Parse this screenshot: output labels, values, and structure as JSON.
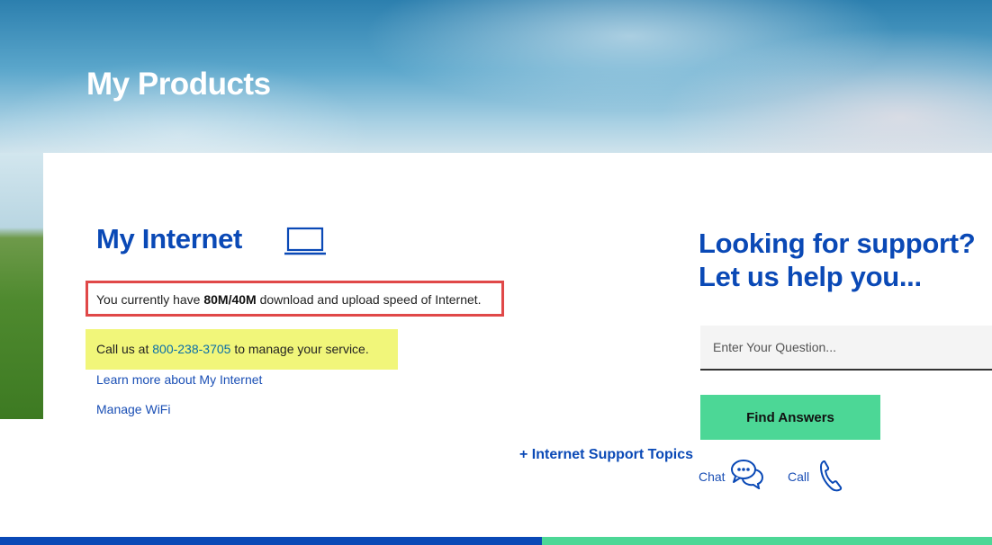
{
  "header": {
    "title": "My Products"
  },
  "internet": {
    "title": "My Internet",
    "speed_prefix": "You currently have ",
    "speed_value": "80M/40M",
    "speed_suffix": " download and upload speed of Internet.",
    "call_prefix": "Call us at ",
    "call_phone": "800-238-3705",
    "call_suffix": " to manage your service.",
    "learn_more_link": "Learn more about My Internet",
    "manage_wifi_link": "Manage WiFi",
    "support_topics_link": "+ Internet Support Topics"
  },
  "support": {
    "heading_line1": "Looking for support?",
    "heading_line2": "Let us help you...",
    "search_placeholder": "Enter Your Question...",
    "find_button": "Find Answers",
    "chat_label": "Chat",
    "call_label": "Call"
  },
  "colors": {
    "brand_blue": "#0a49b6",
    "accent_green": "#4cd796",
    "highlight_red": "#e04848",
    "highlight_yellow": "#f1f67a"
  },
  "icons": {
    "laptop": "laptop-icon",
    "chat": "chat-bubbles-icon",
    "call": "phone-icon"
  }
}
